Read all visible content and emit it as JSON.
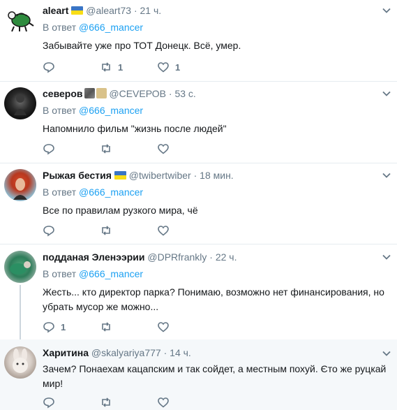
{
  "colors": {
    "link": "#1da1f2",
    "muted": "#657786",
    "text": "#14171a",
    "highlight_bg": "#f5f8fa"
  },
  "tweets": [
    {
      "name": "aleart",
      "handle": "@aleart73",
      "dot": "·",
      "time": "21 ч.",
      "reply_prefix": "В ответ",
      "reply_handle": "@666_mancer",
      "text": "Забывайте уже про ТОТ Донецк. Всё, умер.",
      "retweets": "1",
      "likes": "1",
      "replies": ""
    },
    {
      "name": "северов",
      "handle": "@СЕVЕРОВ",
      "dot": "·",
      "time": "53 с.",
      "reply_prefix": "В ответ",
      "reply_handle": "@666_mancer",
      "text": "Напомнило фильм \"жизнь после людей\"",
      "retweets": "",
      "likes": "",
      "replies": ""
    },
    {
      "name": "Рыжая бестия",
      "handle": "@twibertwiber",
      "dot": "·",
      "time": "18 мин.",
      "reply_prefix": "В ответ",
      "reply_handle": "@666_mancer",
      "text": "Все по правилам рузкого мира, чё",
      "retweets": "",
      "likes": "",
      "replies": ""
    },
    {
      "name": "подданая Эленээрии",
      "handle": "@DPRfrankly",
      "dot": "·",
      "time": "22 ч.",
      "reply_prefix": "В ответ",
      "reply_handle": "@666_mancer",
      "text_line1": "Жесть... кто директор парка? Понимаю, возможно нет финансирования, но",
      "text_line2": "убрать мусор же можно...",
      "replies": "1",
      "retweets": "",
      "likes": ""
    },
    {
      "name": "Харитина",
      "handle": "@skalyariya777",
      "dot": "·",
      "time": "14 ч.",
      "text_line1": "Зачем? Понаехам кацапским и так сойдет, а местным похуй. Єто же руцкай",
      "text_line2": "мир!",
      "replies": "",
      "retweets": "",
      "likes": ""
    }
  ]
}
